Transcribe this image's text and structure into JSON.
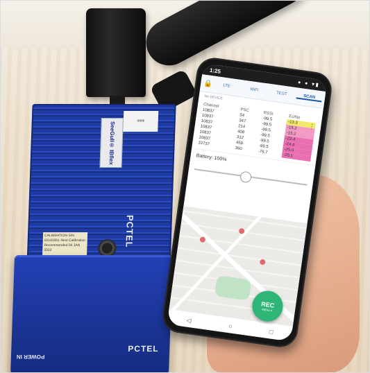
{
  "device": {
    "model_label": "SeeGull® IBflex",
    "brand_label": "PCTEL",
    "power_label": "POWER IN",
    "calibration_text": "CALIBRATION S/N: 02183301 Next Calibration Recommended 04 JAN 2022"
  },
  "phone": {
    "status_time": "1:25",
    "tabs": [
      "LTE",
      "WiFi",
      "TEST",
      "SCAN"
    ],
    "active_tab": "SCAN",
    "device_name": "No DEVICE",
    "table": {
      "headers": [
        "Channel",
        "PSC",
        "RSSI",
        "Ec/No"
      ],
      "rows": [
        {
          "channel": "10837",
          "psc": "54",
          "rssi": "-99.5",
          "ecno": "-13.3"
        },
        {
          "channel": "10837",
          "psc": "347",
          "rssi": "-99.5",
          "ecno": "-15.2"
        },
        {
          "channel": "10837",
          "psc": "214",
          "rssi": "-99.5",
          "ecno": "-15.2"
        },
        {
          "channel": "10837",
          "psc": "408",
          "rssi": "-99.5",
          "ecno": "-22.4"
        },
        {
          "channel": "10837",
          "psc": "312",
          "rssi": "-99.5",
          "ecno": "-24.4"
        },
        {
          "channel": "10837",
          "psc": "459",
          "rssi": "-99.5",
          "ecno": "-25.0"
        },
        {
          "channel": "10737",
          "psc": "360",
          "rssi": "-76.7",
          "ecno": "-25.1"
        }
      ]
    },
    "battery_text": "Battery: 100%",
    "slider_value": 0.45,
    "rec_label": "REC",
    "rec_sub": "MENU ▾",
    "colors": {
      "ecno_yellow": "#f2e86a",
      "ecno_pink": "#f29ac4",
      "ecno_magenta": "#ea6fb2",
      "rec_green": "#2fb575",
      "tab_blue": "#1c56a5"
    }
  }
}
